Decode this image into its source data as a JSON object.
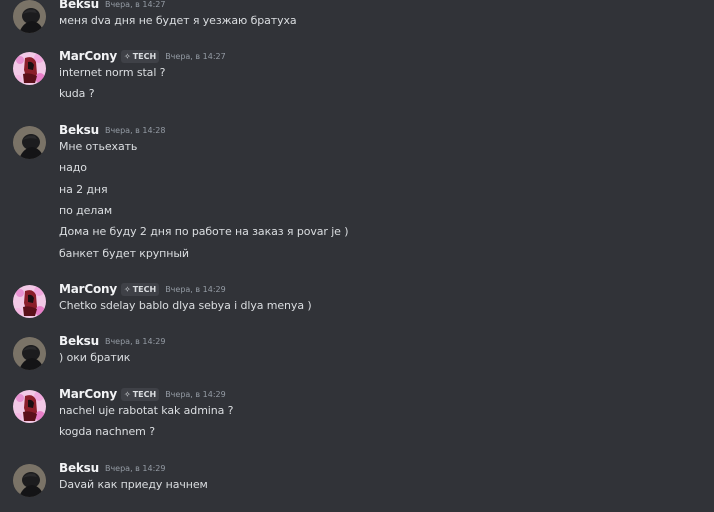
{
  "messages": [
    {
      "author": "Beksu",
      "avatar": "beksu-avatar",
      "tag": "",
      "time": "Вчера, в 14:27",
      "lines": [
        "меня dva дня не будет я уезжаю  братуха"
      ]
    },
    {
      "author": "MarCony",
      "avatar": "marcony-avatar",
      "tag": "TECH",
      "time": "Вчера, в 14:27",
      "lines": [
        "internet norm stal ?",
        "kuda ?"
      ]
    },
    {
      "author": "Beksu",
      "avatar": "beksu-avatar",
      "tag": "",
      "time": "Вчера, в 14:28",
      "lines": [
        "Мне отьехать",
        "надо",
        "на 2 дня",
        "по делам",
        "Дома не буду 2 дня по работе на заказ я povar je )",
        "банкет будет крупный"
      ]
    },
    {
      "author": "MarCony",
      "avatar": "marcony-avatar",
      "tag": "TECH",
      "time": "Вчера, в 14:29",
      "lines": [
        "Chetko sdelay bablo dlya sebya i dlya menya )"
      ]
    },
    {
      "author": "Beksu",
      "avatar": "beksu-avatar",
      "tag": "",
      "time": "Вчера, в 14:29",
      "lines": [
        ") оки братик"
      ]
    },
    {
      "author": "MarCony",
      "avatar": "marcony-avatar",
      "tag": "TECH",
      "time": "Вчера, в 14:29",
      "lines": [
        "nachel uje rabotat kak admina ?",
        "kogda nachnem ?"
      ]
    },
    {
      "author": "Beksu",
      "avatar": "beksu-avatar",
      "tag": "",
      "time": "Вчера, в 14:29",
      "lines": [
        "Davай как приеду начнем"
      ]
    }
  ],
  "theme": {
    "background": "#313338",
    "text": "#dbdee1",
    "username": "#f2f3f5",
    "timestamp": "#949ba4",
    "tag_bg": "#3f4147"
  }
}
